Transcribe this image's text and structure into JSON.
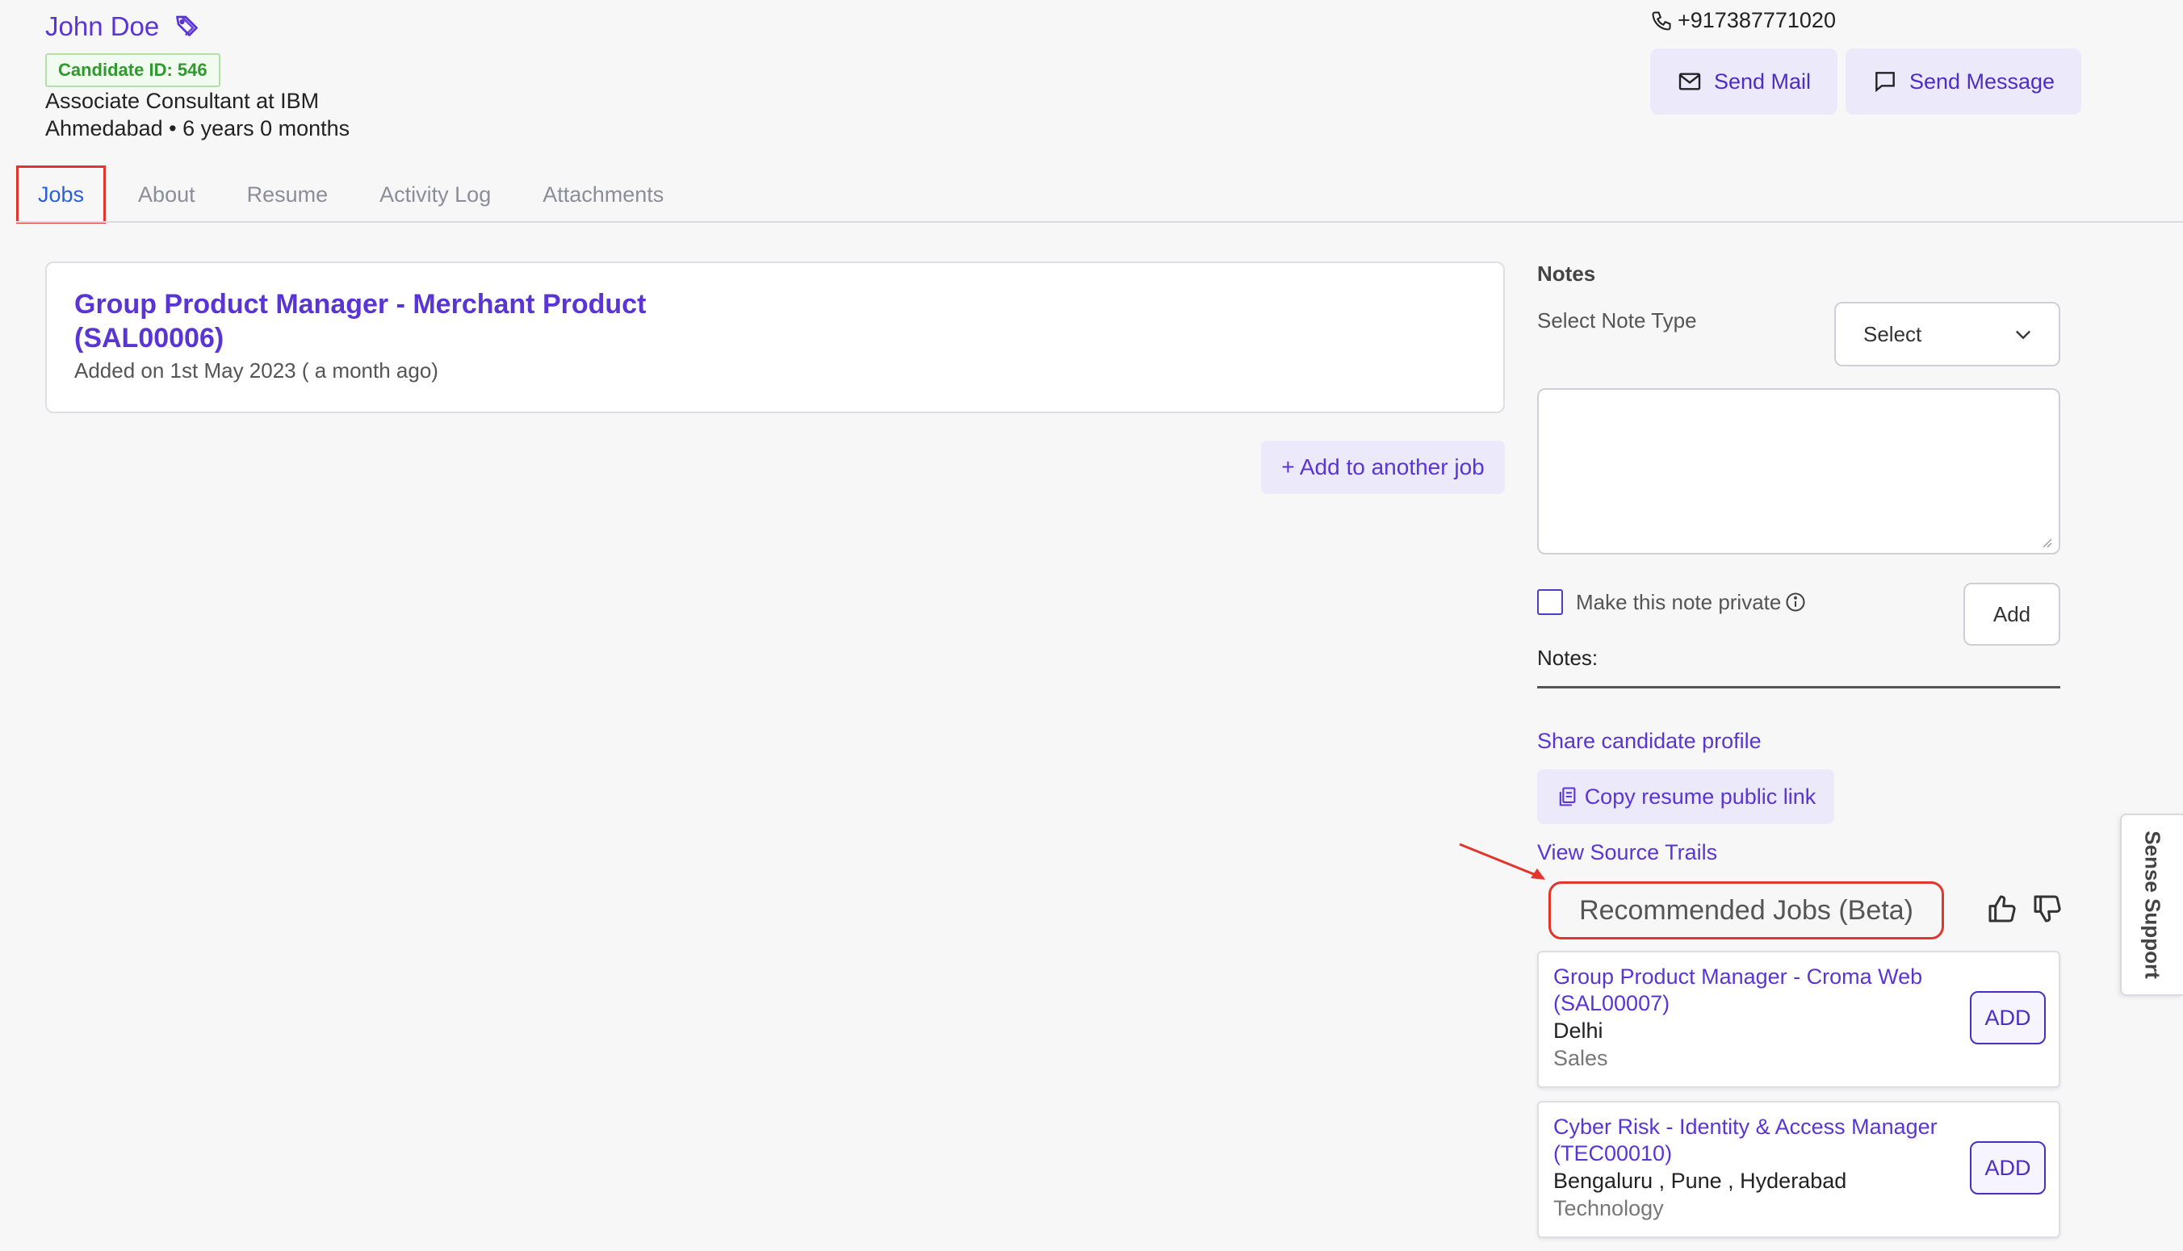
{
  "candidate": {
    "name": "John Doe",
    "id_badge": "Candidate ID: 546",
    "position": "Associate Consultant at IBM",
    "location_experience": "Ahmedabad • 6 years 0 months",
    "phone": "+917387771020"
  },
  "actions": {
    "send_mail": "Send Mail",
    "send_message": "Send Message"
  },
  "tabs": [
    {
      "label": "Jobs",
      "active": true
    },
    {
      "label": "About"
    },
    {
      "label": "Resume"
    },
    {
      "label": "Activity Log"
    },
    {
      "label": "Attachments"
    }
  ],
  "job": {
    "title": "Group Product Manager - Merchant Product (SAL00006)",
    "added": "Added on 1st May 2023 ( a month ago)"
  },
  "add_job_label": "+ Add to another job",
  "notes": {
    "heading": "Notes",
    "select_type_label": "Select Note Type",
    "select_value": "Select",
    "private_label": "Make this note private",
    "add_label": "Add",
    "notes_label": "Notes:"
  },
  "links": {
    "share": "Share candidate profile",
    "copy_resume": "Copy resume public link",
    "source_trails": "View Source Trails"
  },
  "recommended": {
    "heading": "Recommended Jobs (Beta)",
    "jobs": [
      {
        "title": "Group Product Manager - Croma Web (SAL00007)",
        "location": "Delhi",
        "department": "Sales",
        "add": "ADD"
      },
      {
        "title": "Cyber Risk - Identity & Access Manager (TEC00010)",
        "location": "Bengaluru , Pune , Hyderabad",
        "department": "Technology",
        "add": "ADD"
      }
    ]
  },
  "side_tab": "Sense Support",
  "colors": {
    "accent": "#5a35d6",
    "highlight": "#e0362b",
    "button_bg": "#ece9fb",
    "badge_green": "#2e9a2e"
  }
}
